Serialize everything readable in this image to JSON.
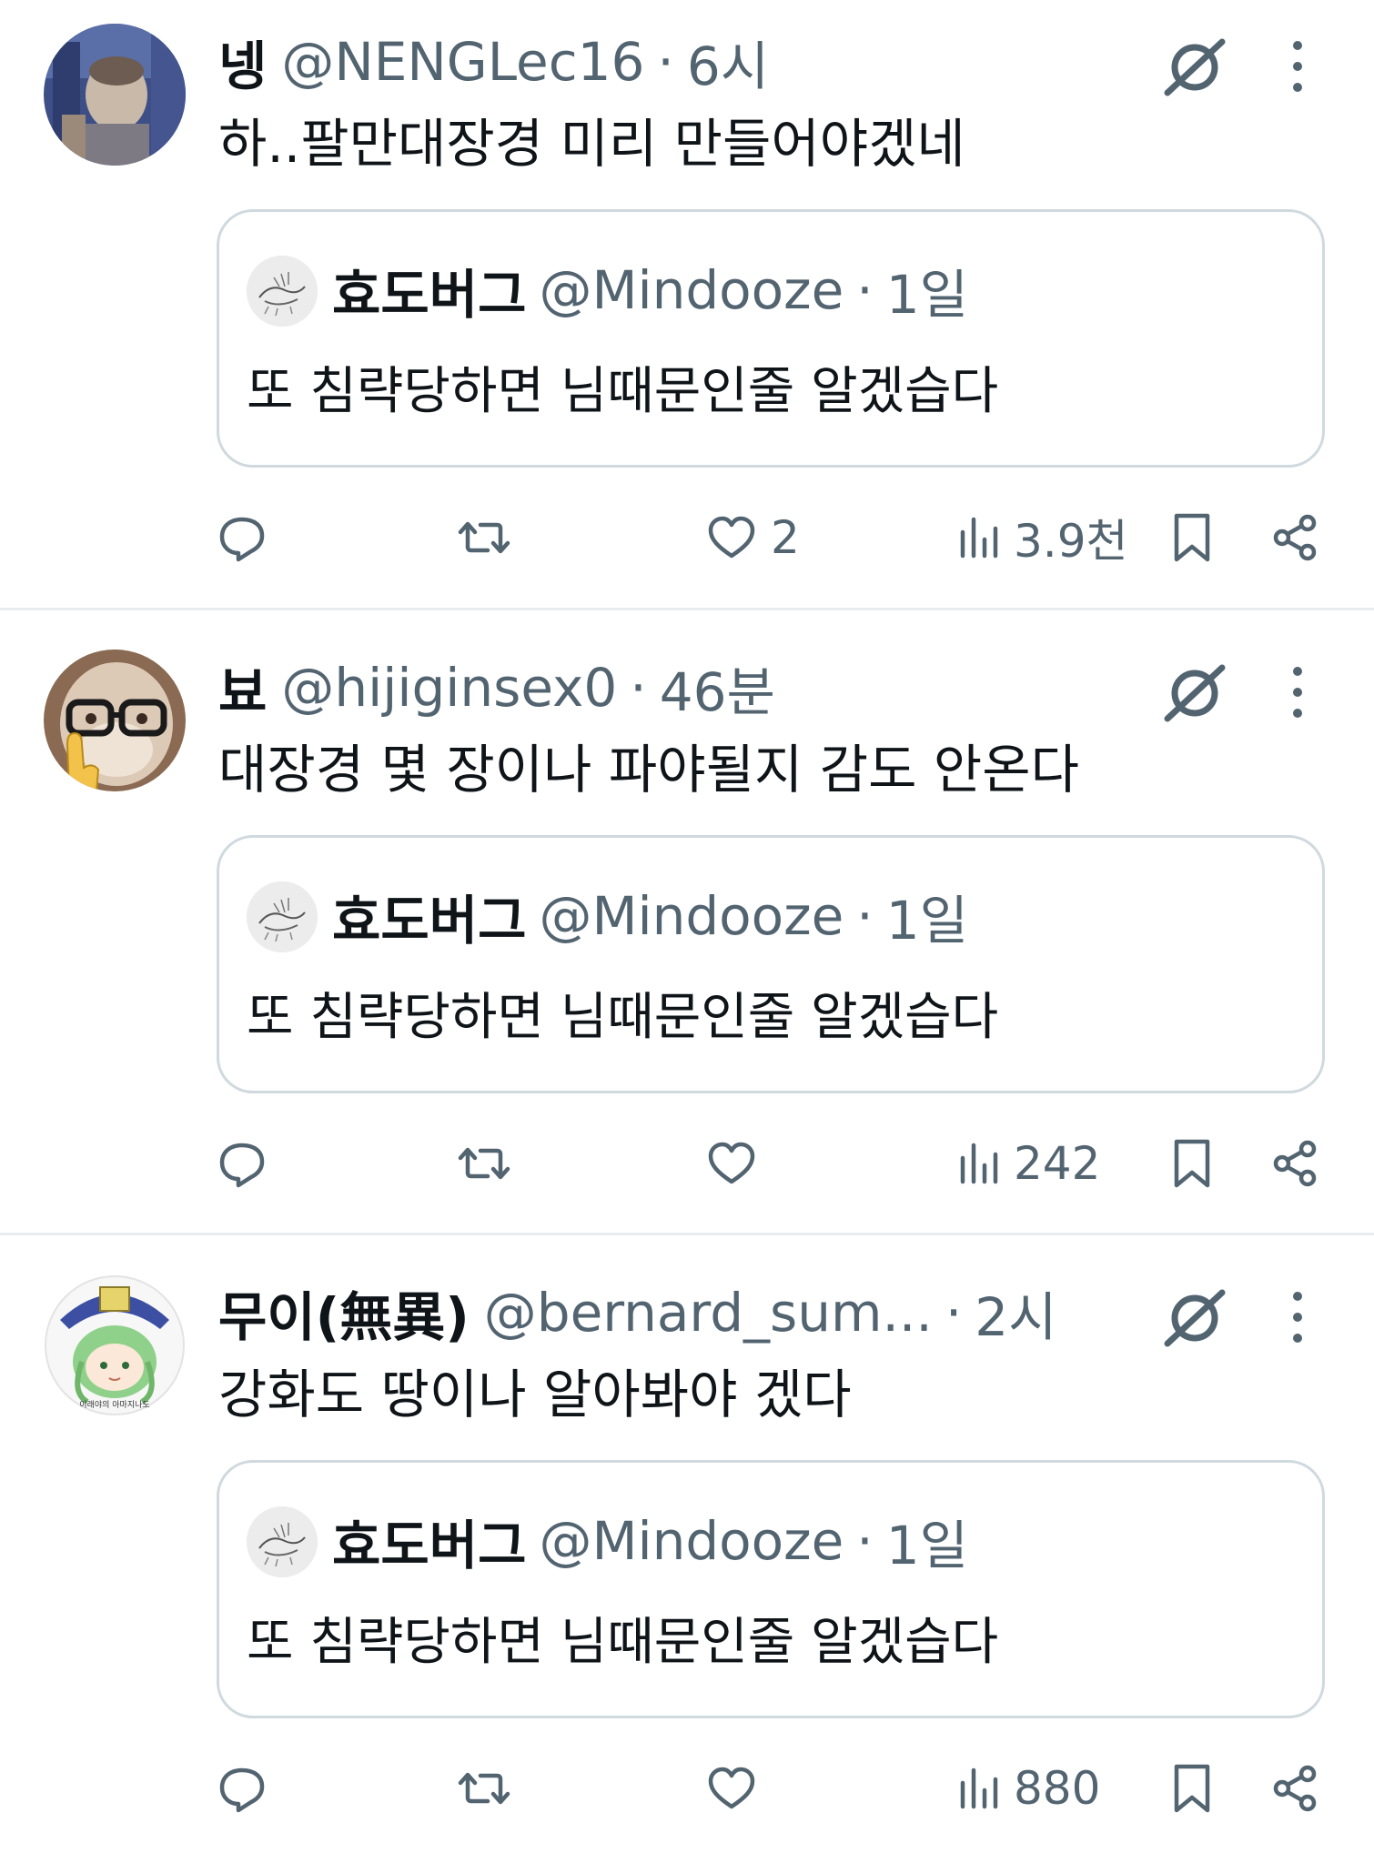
{
  "colors": {
    "text_primary": "#0f1419",
    "text_secondary": "#536471",
    "border": "#cfd9de",
    "divider": "#e8ecef"
  },
  "tweets": [
    {
      "name": "넹",
      "handle": "@NENGLec16",
      "separator": "·",
      "time": "6시",
      "text": "하..팔만대장경 미리 만들어야겠네",
      "quote": {
        "name": "효도버그",
        "handle": "@Mindooze",
        "separator": "·",
        "time": "1일",
        "text": "또 침략당하면 님때문인줄 알겠습다"
      },
      "actions": {
        "reply_icon": "reply-icon",
        "retweet_icon": "retweet-icon",
        "like_icon": "heart-icon",
        "likes": "2",
        "views_icon": "views-icon",
        "views": "3.9천",
        "bookmark_icon": "bookmark-icon",
        "share_icon": "share-icon"
      }
    },
    {
      "name": "뵤",
      "handle": "@hijiginsex0",
      "separator": "·",
      "time": "46분",
      "text": "대장경 몇 장이나 파야될지 감도 안온다",
      "quote": {
        "name": "효도버그",
        "handle": "@Mindooze",
        "separator": "·",
        "time": "1일",
        "text": "또 침략당하면 님때문인줄 알겠습다"
      },
      "actions": {
        "likes": "",
        "views": "242"
      }
    },
    {
      "name": "무이(無異)",
      "handle": "@bernard_sum...",
      "separator": "·",
      "time": "2시",
      "text": "강화도 땅이나 알아봐야 겠다",
      "avatar_caption": "이래야의 아마지나도",
      "quote": {
        "name": "효도버그",
        "handle": "@Mindooze",
        "separator": "·",
        "time": "1일",
        "text": "또 침략당하면 님때문인줄 알겠습다"
      },
      "actions": {
        "likes": "",
        "views": "880"
      }
    }
  ]
}
